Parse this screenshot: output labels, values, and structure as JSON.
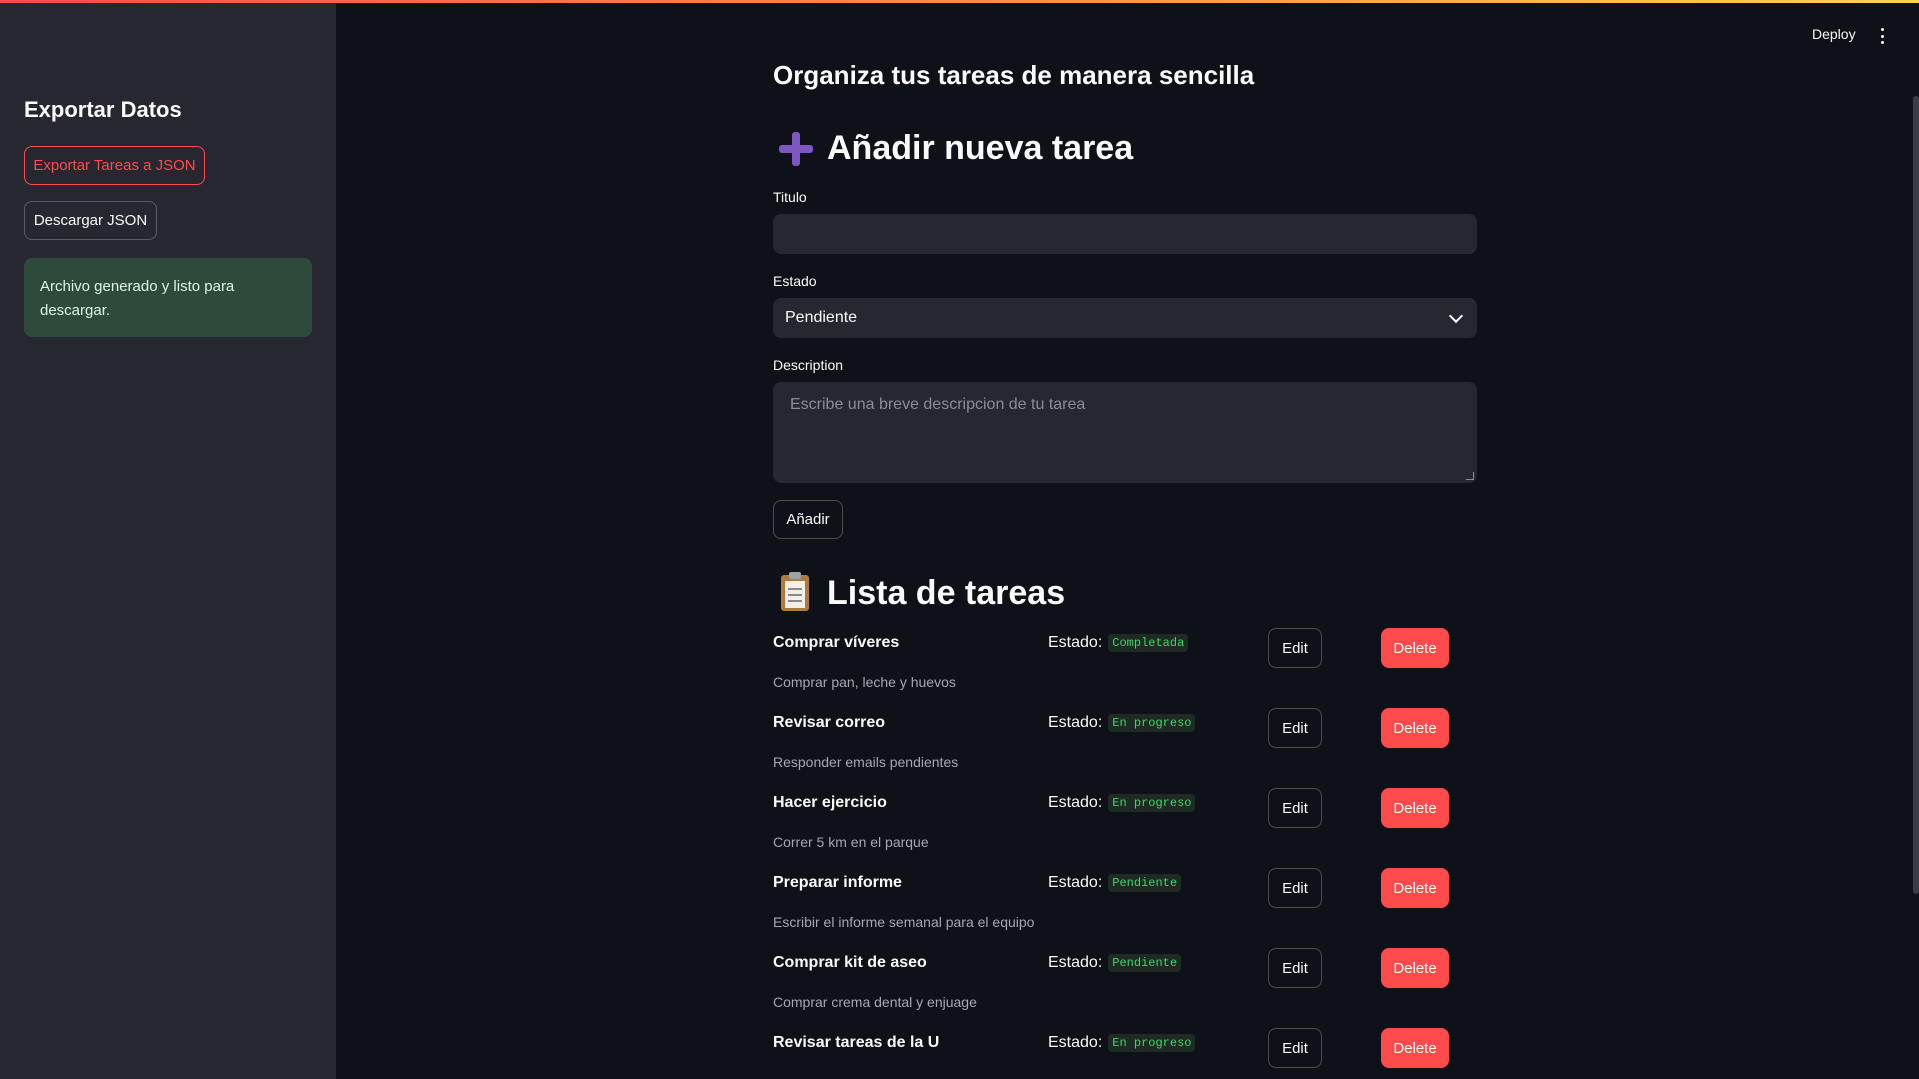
{
  "colors": {
    "accent": "#ff4b4b",
    "success_bg": "#2d4a3a",
    "status_green": "#3dd56d",
    "background": "#0e1117",
    "sidebar": "#262730"
  },
  "header": {
    "deploy_label": "Deploy",
    "menu_icon": "vertical-dots-icon"
  },
  "sidebar": {
    "title": "Exportar Datos",
    "export_button": "Exportar Tareas a JSON",
    "download_button": "Descargar JSON",
    "success_message": "Archivo generado y listo para descargar."
  },
  "main": {
    "subtitle": "Organiza tus tareas de manera sencilla",
    "add_section": {
      "icon": "plus-icon",
      "title": "Añadir nueva tarea",
      "title_label": "Titulo",
      "title_value": "",
      "status_label": "Estado",
      "status_value": "Pendiente",
      "description_label": "Description",
      "description_placeholder": "Escribe una breve descripcion de tu tarea",
      "add_button": "Añadir"
    },
    "list_section": {
      "icon": "clipboard-icon",
      "title": "Lista de tareas",
      "status_prefix": "Estado:",
      "edit_label": "Edit",
      "delete_label": "Delete",
      "tasks": [
        {
          "title": "Comprar víveres",
          "status": "Completada",
          "description": "Comprar pan, leche y huevos"
        },
        {
          "title": "Revisar correo",
          "status": "En progreso",
          "description": "Responder emails pendientes"
        },
        {
          "title": "Hacer ejercicio",
          "status": "En progreso",
          "description": "Correr 5 km en el parque"
        },
        {
          "title": "Preparar informe",
          "status": "Pendiente",
          "description": "Escribir el informe semanal para el equipo"
        },
        {
          "title": "Comprar kit de aseo",
          "status": "Pendiente",
          "description": "Comprar crema dental y enjuage"
        },
        {
          "title": "Revisar tareas de la U",
          "status": "En progreso",
          "description": ""
        }
      ]
    }
  }
}
